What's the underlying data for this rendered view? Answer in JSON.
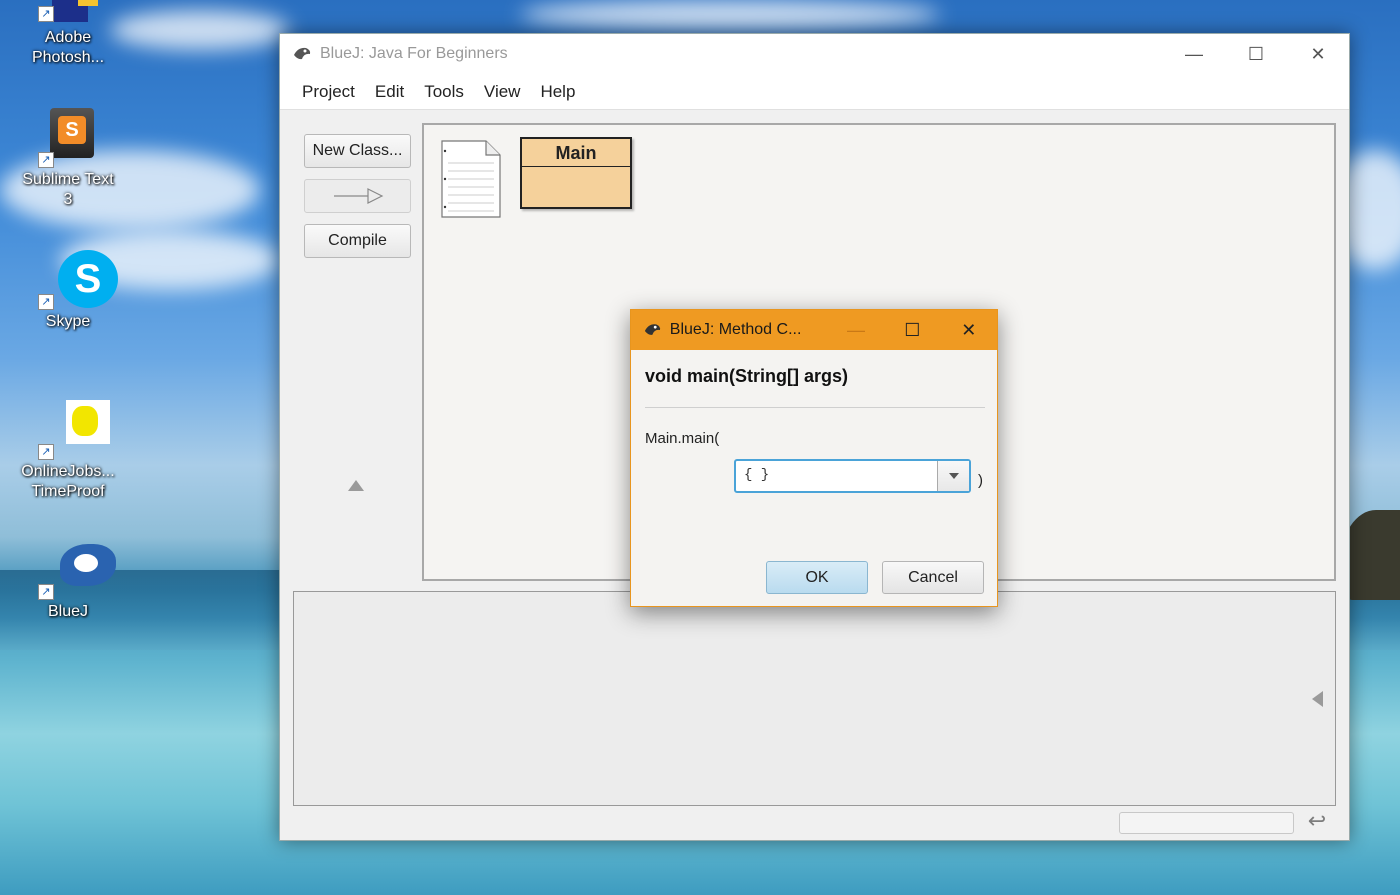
{
  "desktop": {
    "icons": [
      {
        "label": "Adobe Photosh...",
        "name": "adobe-photoshop"
      },
      {
        "label": "Sublime Text 3",
        "name": "sublime-text"
      },
      {
        "label": "Skype",
        "name": "skype"
      },
      {
        "label": "OnlineJobs... TimeProof",
        "name": "onlinejobs-timeproof"
      },
      {
        "label": "BlueJ",
        "name": "bluej"
      }
    ],
    "sublime_letter": "S",
    "skype_letter": "S"
  },
  "window": {
    "title": "BlueJ:  Java For Beginners",
    "menu": [
      "Project",
      "Edit",
      "Tools",
      "View",
      "Help"
    ],
    "buttons": {
      "new_class": "New Class...",
      "inherit_arrow": "",
      "compile": "Compile"
    },
    "class_name": "Main"
  },
  "dialog": {
    "title": "BlueJ:  Method C...",
    "signature": "void main(String[] args)",
    "call_prefix": "Main.main(",
    "arg_value": "{ }",
    "call_suffix": ")",
    "ok_label": "OK",
    "cancel_label": "Cancel"
  },
  "colors": {
    "dialog_title": "#ef9a22",
    "class_fill": "#f5d19b"
  }
}
